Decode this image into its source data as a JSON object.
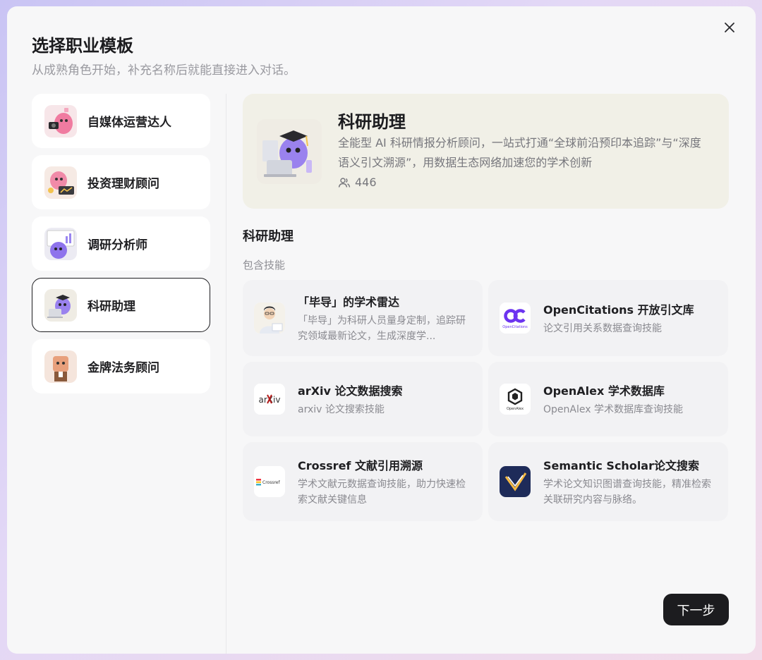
{
  "colors": {
    "accent": "#1c1c1f",
    "hero_bg": "#f1f0e7",
    "card_bg": "#f2f2f4",
    "muted_text": "#8a8a90"
  },
  "dialog": {
    "title": "选择职业模板",
    "subtitle": "从成熟角色开始，补充名称后就能直接进入对话。",
    "close_icon": "close-icon"
  },
  "sidebar": {
    "items": [
      {
        "label": "自媒体运营达人",
        "icon": "social-media-avatar"
      },
      {
        "label": "投资理财顾问",
        "icon": "finance-avatar"
      },
      {
        "label": "调研分析师",
        "icon": "analyst-avatar"
      },
      {
        "label": "科研助理",
        "icon": "research-avatar",
        "selected": true
      },
      {
        "label": "金牌法务顾问",
        "icon": "legal-avatar"
      }
    ]
  },
  "hero": {
    "title": "科研助理",
    "description": "全能型 AI 科研情报分析顾问，一站式打通“全球前沿预印本追踪”与“深度语义引文溯源”，用数据生态网络加速您的学术创新",
    "count": "446",
    "count_icon": "users-icon"
  },
  "section": {
    "title": "科研助理",
    "skills_label": "包含技能"
  },
  "skills": [
    {
      "name": "「毕导」的学术雷达",
      "desc": "「毕导」为科研人员量身定制，追踪研究领域最新论文，生成深度学...",
      "icon": "bidao-avatar-icon"
    },
    {
      "name": "OpenCitations 开放引文库",
      "desc": "论文引用关系数据查询技能",
      "icon": "opencitations-logo-icon"
    },
    {
      "name": "arXiv 论文数据搜索",
      "desc": "arxiv 论文搜索技能",
      "icon": "arxiv-logo-icon"
    },
    {
      "name": "OpenAlex 学术数据库",
      "desc": "OpenAlex 学术数据库查询技能",
      "icon": "openalex-logo-icon"
    },
    {
      "name": "Crossref 文献引用溯源",
      "desc": "学术文献元数据查询技能，助力快速检索文献关键信息",
      "icon": "crossref-logo-icon"
    },
    {
      "name": "Semantic Scholar论文搜索",
      "desc": "学术论文知识图谱查询技能，精准检索关联研究内容与脉络。",
      "icon": "semantic-scholar-logo-icon"
    }
  ],
  "logo_text": {
    "arxiv": "arXiv",
    "opencitations": "OpenCitations",
    "openalex": "OpenAlex",
    "crossref": "Crossref"
  },
  "footer": {
    "next_label": "下一步"
  }
}
